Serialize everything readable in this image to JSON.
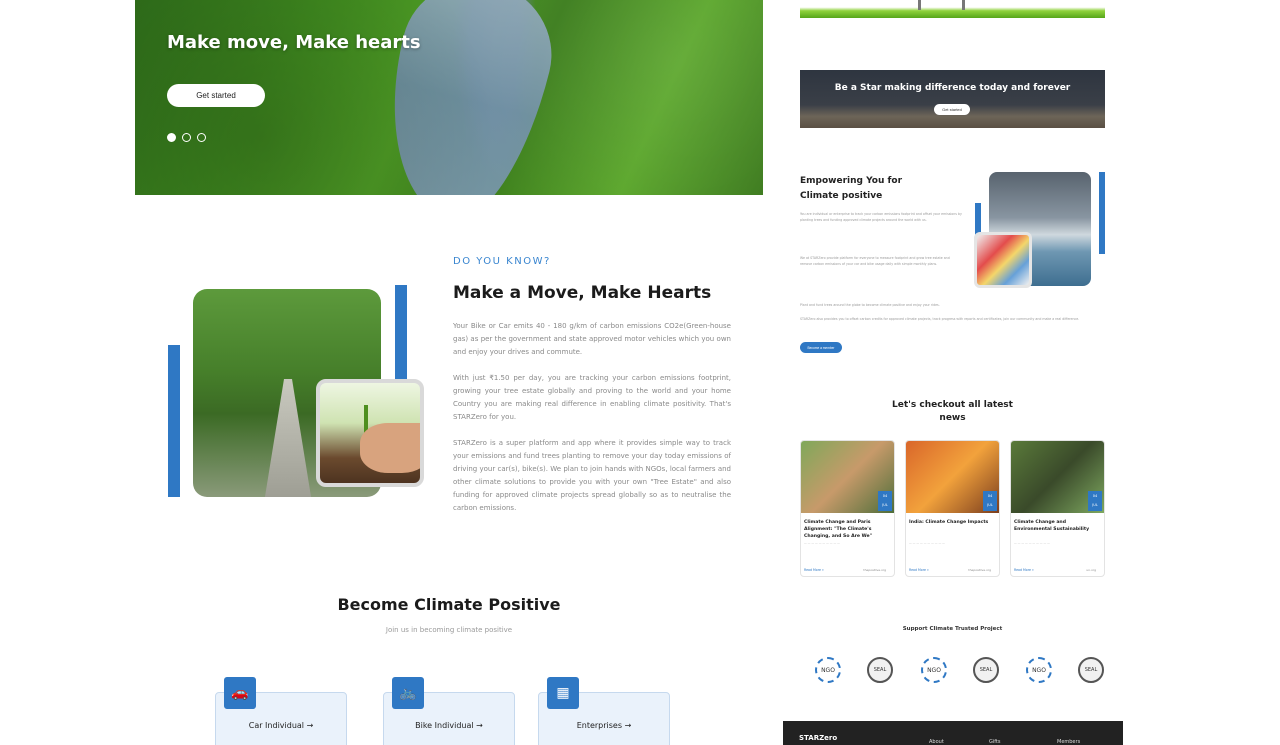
{
  "hero": {
    "title": "Make move, Make hearts",
    "cta_label": "Get started",
    "dots": 3
  },
  "did_you_know": {
    "kicker": "DO YOU KNOW?",
    "title": "Make a Move, Make Hearts",
    "p1": "Your Bike or Car emits 40 - 180 g/km of carbon emissions CO2e(Green-house gas) as per the government and state approved motor vehicles which you own and enjoy your drives and commute.",
    "p2": "With just ₹1.50 per day, you are tracking your carbon emissions footprint, growing your tree estate globally and proving to the world and your home Country you are making real difference in enabling climate positivity. That's STARZero for you.",
    "p3": "STARZero is a super platform and app where it provides simple way to track your emissions and fund trees planting to remove your day today emissions of driving your car(s), bike(s). We plan to join hands with NGOs, local farmers and other climate solutions to provide you with your own \"Tree Estate\" and also funding for approved climate projects spread globally so as to neutralise the carbon emissions."
  },
  "become": {
    "title": "Become Climate Positive",
    "subtitle": "Join us in becoming climate positive",
    "cards": [
      {
        "label": "Car Individual",
        "arrow": "→",
        "icon": "car-icon"
      },
      {
        "label": "Bike Individual",
        "arrow": "→",
        "icon": "bike-icon"
      },
      {
        "label": "Enterprises",
        "arrow": "→",
        "icon": "building-icon"
      }
    ]
  },
  "banner": {
    "title": "Be a Star making difference today and forever",
    "cta_label": "Get started"
  },
  "empowering": {
    "title": "Empowering You for Climate positive",
    "p1": "You are individual or enterprise to track your carbon emissions footprint and offset your emissions by planting trees and funding approved climate projects around the world with us.",
    "p2": "We at STARZero provide platform for everyone to measure footprint and grow tree estate and remove carbon emissions of your car and bike usage daily with simple monthly plans.",
    "p3": "Plant and fund trees around the globe to become climate positive and enjoy your rides.",
    "p4": "STARZero also provides you to offset carbon credits for approved climate projects, track progress with reports and certificates, join our community and make a real difference.",
    "cta_label": "Become a member"
  },
  "news": {
    "title": "Let's checkout all latest news",
    "items": [
      {
        "title": "Climate Change and Paris Alignment: \"The Climate's Changing, and So Are We\"",
        "day": "04",
        "month": "JUL",
        "read": "Read More »",
        "source": "thepositive.org"
      },
      {
        "title": "India: Climate Change Impacts",
        "day": "04",
        "month": "JUL",
        "read": "Read More »",
        "source": "thepositive.org"
      },
      {
        "title": "Climate Change and Environmental Sustainability",
        "day": "04",
        "month": "JUL",
        "read": "Read More »",
        "source": "un.org"
      }
    ]
  },
  "support": {
    "title": "Support Climate Trusted Project",
    "logos": [
      "NGO",
      "SEAL",
      "NGO",
      "SEAL",
      "NGO",
      "SEAL"
    ]
  },
  "footer": {
    "brand": "STARZero",
    "links": [
      "About",
      "Gifts",
      "Members"
    ]
  },
  "colors": {
    "accent": "#2f78c4",
    "footer": "#222222"
  }
}
